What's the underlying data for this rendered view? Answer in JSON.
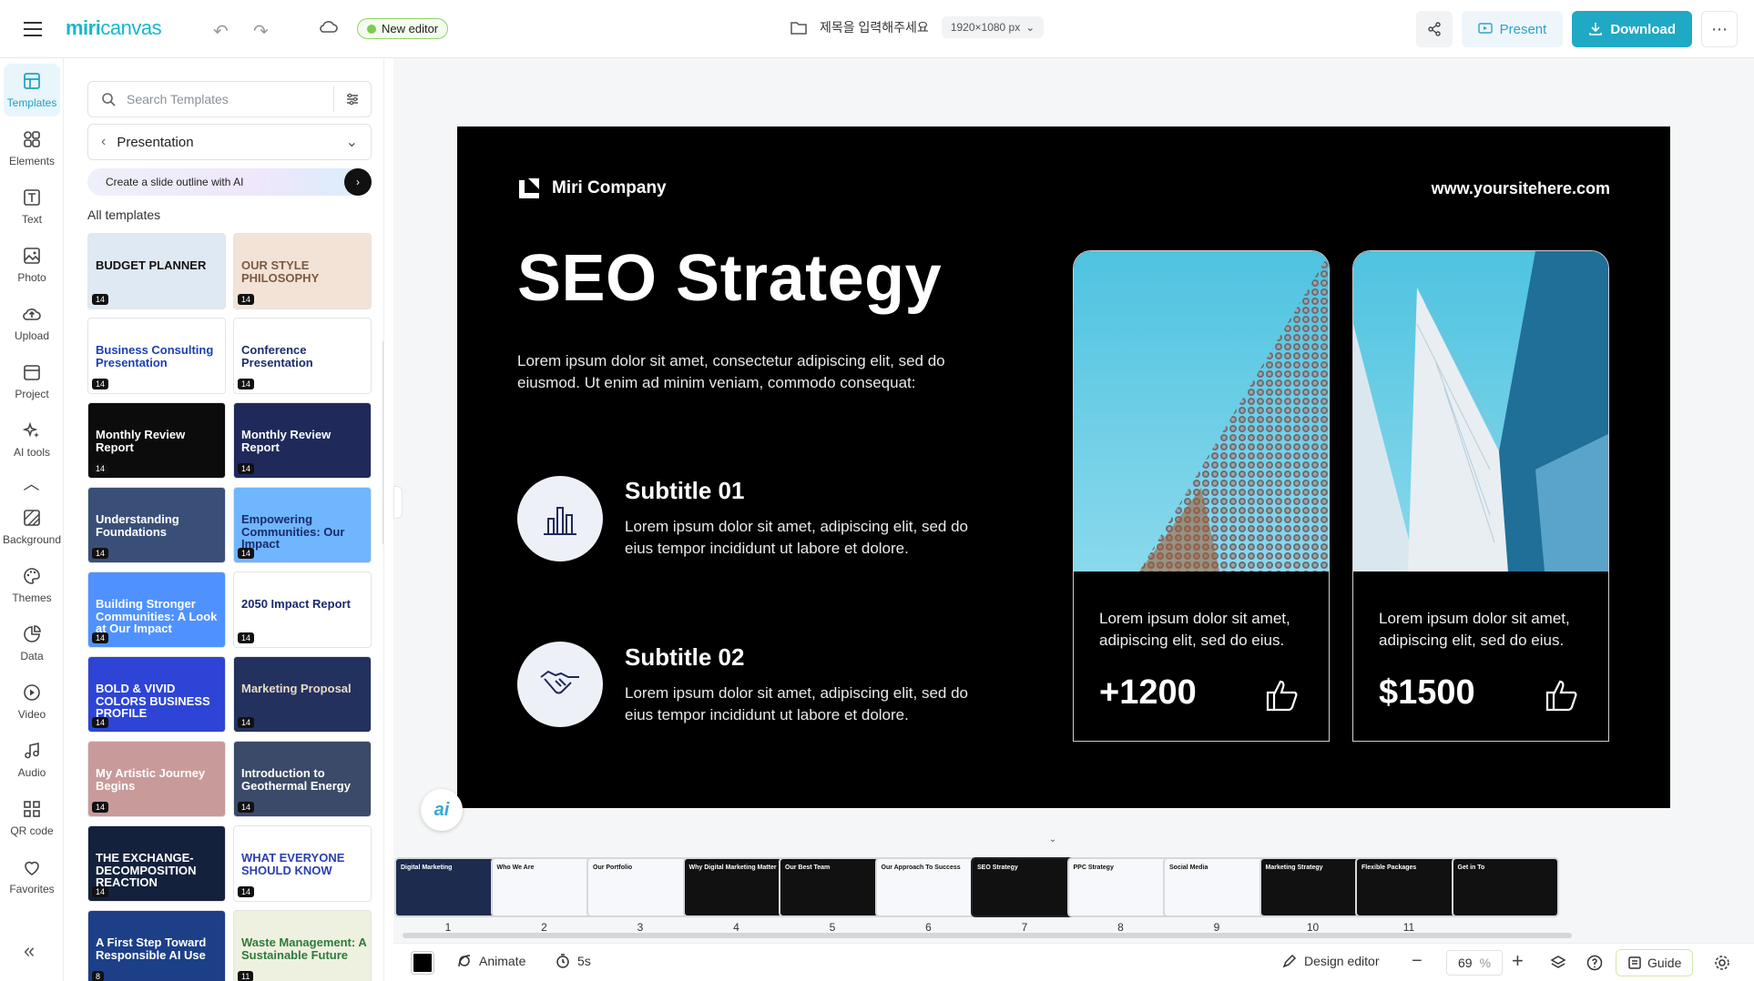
{
  "topbar": {
    "logo": "miri",
    "logo_suffix": "canvas",
    "new_editor_label": "New editor",
    "doc_title": "제목을 입력해주세요",
    "canvas_size": "1920×1080 px",
    "present_label": "Present",
    "download_label": "Download"
  },
  "nav": {
    "items": [
      {
        "label": "Templates"
      },
      {
        "label": "Elements"
      },
      {
        "label": "Text"
      },
      {
        "label": "Photo"
      },
      {
        "label": "Upload"
      },
      {
        "label": "Project"
      },
      {
        "label": "AI tools"
      },
      {
        "label": "Background"
      },
      {
        "label": "Themes"
      },
      {
        "label": "Data"
      },
      {
        "label": "Video"
      },
      {
        "label": "Audio"
      },
      {
        "label": "QR code"
      },
      {
        "label": "Favorites"
      }
    ]
  },
  "panel": {
    "search_placeholder": "Search Templates",
    "category": "Presentation",
    "ai_banner": "Create a slide outline with AI",
    "all_templates_label": "All templates",
    "templates": [
      {
        "title": "BUDGET PLANNER",
        "count": "14",
        "bg": "#dfe9f3",
        "fg": "#111"
      },
      {
        "title": "OUR STYLE PHILOSOPHY",
        "count": "14",
        "bg": "#f3e3d6",
        "fg": "#7a5a44"
      },
      {
        "title": "Business Consulting Presentation",
        "count": "14",
        "bg": "#ffffff",
        "fg": "#1b3fb3"
      },
      {
        "title": "Conference Presentation",
        "count": "14",
        "bg": "#ffffff",
        "fg": "#1c2d6b"
      },
      {
        "title": "Monthly Review Report",
        "count": "14",
        "bg": "#0c0c0c",
        "fg": "#ffffff"
      },
      {
        "title": "Monthly Review Report",
        "count": "14",
        "bg": "#1f2a5a",
        "fg": "#ffffff"
      },
      {
        "title": "Understanding Foundations",
        "count": "14",
        "bg": "#3a4f78",
        "fg": "#ffffff"
      },
      {
        "title": "Empowering Communities: Our Impact",
        "count": "14",
        "bg": "#6fb6ff",
        "fg": "#1a2a6b"
      },
      {
        "title": "Building Stronger Communities: A Look at Our Impact",
        "count": "14",
        "bg": "#4f92ff",
        "fg": "#ffffff"
      },
      {
        "title": "2050 Impact Report",
        "count": "14",
        "bg": "#ffffff",
        "fg": "#1a2a6b"
      },
      {
        "title": "BOLD & VIVID COLORS BUSINESS PROFILE",
        "count": "14",
        "bg": "#2d44d6",
        "fg": "#ffffff"
      },
      {
        "title": "Marketing Proposal",
        "count": "14",
        "bg": "#23315f",
        "fg": "#e8dcc4"
      },
      {
        "title": "My Artistic Journey Begins",
        "count": "14",
        "bg": "#c99a9a",
        "fg": "#ffffff"
      },
      {
        "title": "Introduction to Geothermal Energy",
        "count": "14",
        "bg": "#3b4a68",
        "fg": "#ffffff"
      },
      {
        "title": "THE EXCHANGE-DECOMPOSITION REACTION",
        "count": "14",
        "bg": "#14213d",
        "fg": "#ffffff"
      },
      {
        "title": "WHAT EVERYONE SHOULD KNOW",
        "count": "14",
        "bg": "#ffffff",
        "fg": "#2a3fb0"
      },
      {
        "title": "A First Step Toward Responsible AI Use",
        "count": "8",
        "bg": "#1c3f88",
        "fg": "#ffffff"
      },
      {
        "title": "Waste Management: A Sustainable Future",
        "count": "11",
        "bg": "#eef1e0",
        "fg": "#2f7a3a"
      }
    ]
  },
  "slide": {
    "company": "Miri Company",
    "url": "www.yoursitehere.com",
    "title": "SEO Strategy",
    "intro": "Lorem ipsum dolor sit amet, consectetur adipiscing elit, sed do eiusmod. Ut enim ad minim veniam, commodo consequat:",
    "subtitle1": "Subtitle 01",
    "subtitle1_text": "Lorem ipsum dolor sit amet, adipiscing elit, sed do eius tempor incididunt ut labore et dolore.",
    "subtitle2": "Subtitle 02",
    "subtitle2_text": "Lorem ipsum dolor sit amet, adipiscing elit, sed do eius tempor incididunt ut labore et dolore.",
    "card1_text": "Lorem ipsum dolor sit amet, adipiscing elit, sed do eius.",
    "card1_value": "+1200",
    "card2_text": "Lorem ipsum dolor sit amet, adipiscing elit, sed do eius.",
    "card2_value": "$1500"
  },
  "ai_bubble": "ai",
  "filmstrip": {
    "slides": [
      {
        "num": "1",
        "title": "Digital Marketing"
      },
      {
        "num": "2",
        "title": "Who We Are"
      },
      {
        "num": "3",
        "title": "Our Portfolio"
      },
      {
        "num": "4",
        "title": "Why Digital Marketing Matter"
      },
      {
        "num": "5",
        "title": "Our Best Team"
      },
      {
        "num": "6",
        "title": "Our Approach To Success"
      },
      {
        "num": "7",
        "title": "SEO Strategy"
      },
      {
        "num": "8",
        "title": "PPC Strategy"
      },
      {
        "num": "9",
        "title": "Social Media"
      },
      {
        "num": "10",
        "title": "Marketing Strategy"
      },
      {
        "num": "11",
        "title": "Flexible Packages"
      },
      {
        "num": "",
        "title": "Get in To"
      }
    ]
  },
  "bottombar": {
    "animate_label": "Animate",
    "duration": "5s",
    "design_editor_label": "Design editor",
    "zoom": "69",
    "zoom_unit": "%",
    "guide_label": "Guide"
  }
}
